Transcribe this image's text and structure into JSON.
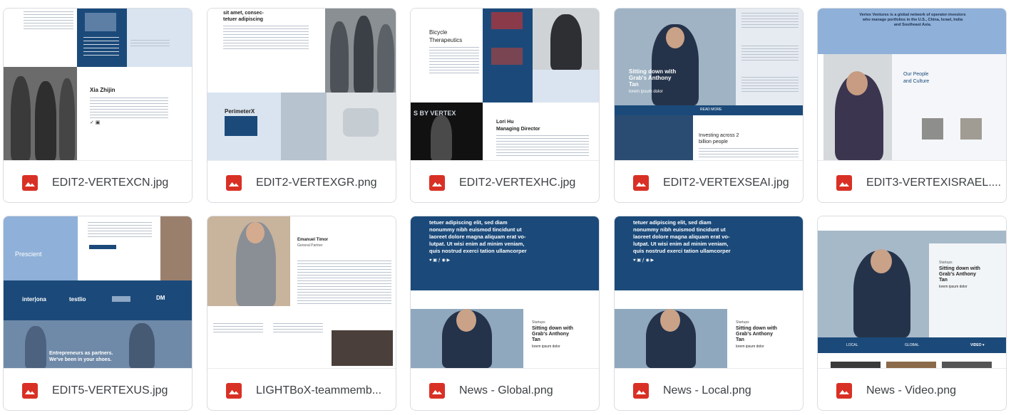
{
  "files": [
    {
      "name": "EDIT2-VERTEXCN.jpg",
      "thumb": {
        "title": "Xia Zhijin",
        "caption": "Read the latest news"
      }
    },
    {
      "name": "EDIT2-VERTEXGR.png",
      "thumb": {
        "heading": "sit amet, consec-\ntetuer adipiscing",
        "subhead": "PerimeterX"
      }
    },
    {
      "name": "EDIT2-VERTEXHC.jpg",
      "thumb": {
        "heading": "Bicycle\nTherapeutics",
        "name": "Lori Hu",
        "role": "Managing Director"
      }
    },
    {
      "name": "EDIT2-VERTEXSEAI.jpg",
      "thumb": {
        "headline": "Sitting down with\nGrab's Anthony\nTan",
        "subline": "lorem ipsum dolor",
        "invest": "Investing across 2\nbillion people",
        "read_more": "READ MORE"
      }
    },
    {
      "name": "EDIT3-VERTEXISRAEL....",
      "thumb": {
        "banner": "Vertex Ventures is a global network of operator-investors\nwho manage portfolios in the U.S., China, Israel, India\nand Southeast Asia.",
        "section": "Our People\nand Culture"
      }
    },
    {
      "name": "EDIT5-VERTEXUS.jpg",
      "thumb": {
        "company": "Prescient",
        "logos": [
          "inter|ona",
          "testlio",
          "",
          "DM"
        ],
        "tagline": "Entrepreneurs as partners.\nWe've been in your shoes."
      }
    },
    {
      "name": "LIGHTBoX-teammemb...",
      "thumb": {
        "name": "Emanuel Timor",
        "role": "General Partner"
      }
    },
    {
      "name": "News - Global.png",
      "thumb": {
        "heading": "tetuer adipiscing elit, sed diam\nnonummy nibh euismod tincidunt ut\nlaoreet dolore magna aliquam erat vo-\nlutpat. Ut wisi enim ad minim veniam,\nquis nostrud exerci tation ullamcorper",
        "category": "Startups",
        "headline": "Sitting down with\nGrab's Anthony\nTan",
        "subline": "lorem ipsum dolor"
      }
    },
    {
      "name": "News - Local.png",
      "thumb": {
        "heading": "tetuer adipiscing elit, sed diam\nnonummy nibh euismod tincidunt ut\nlaoreet dolore magna aliquam erat vo-\nlutpat. Ut wisi enim ad minim veniam,\nquis nostrud exerci tation ullamcorper",
        "category": "Startups",
        "headline": "Sitting down with\nGrab's Anthony\nTan",
        "subline": "lorem ipsum dolor"
      }
    },
    {
      "name": "News - Video.png",
      "thumb": {
        "category": "Startups",
        "headline": "Sitting down with\nGrab's Anthony\nTan",
        "subline": "lorem ipsum dolor",
        "tabs": [
          "LOCAL",
          "GLOBAL",
          "VIDEO ▾"
        ]
      }
    }
  ],
  "icons": {
    "file_type": "image-file-icon"
  },
  "colors": {
    "brand_navy": "#1b4a7a",
    "light_blue": "#8fb0d8",
    "file_icon_red": "#d93025",
    "card_border": "#dadce0",
    "filename_text": "#3c4043"
  }
}
